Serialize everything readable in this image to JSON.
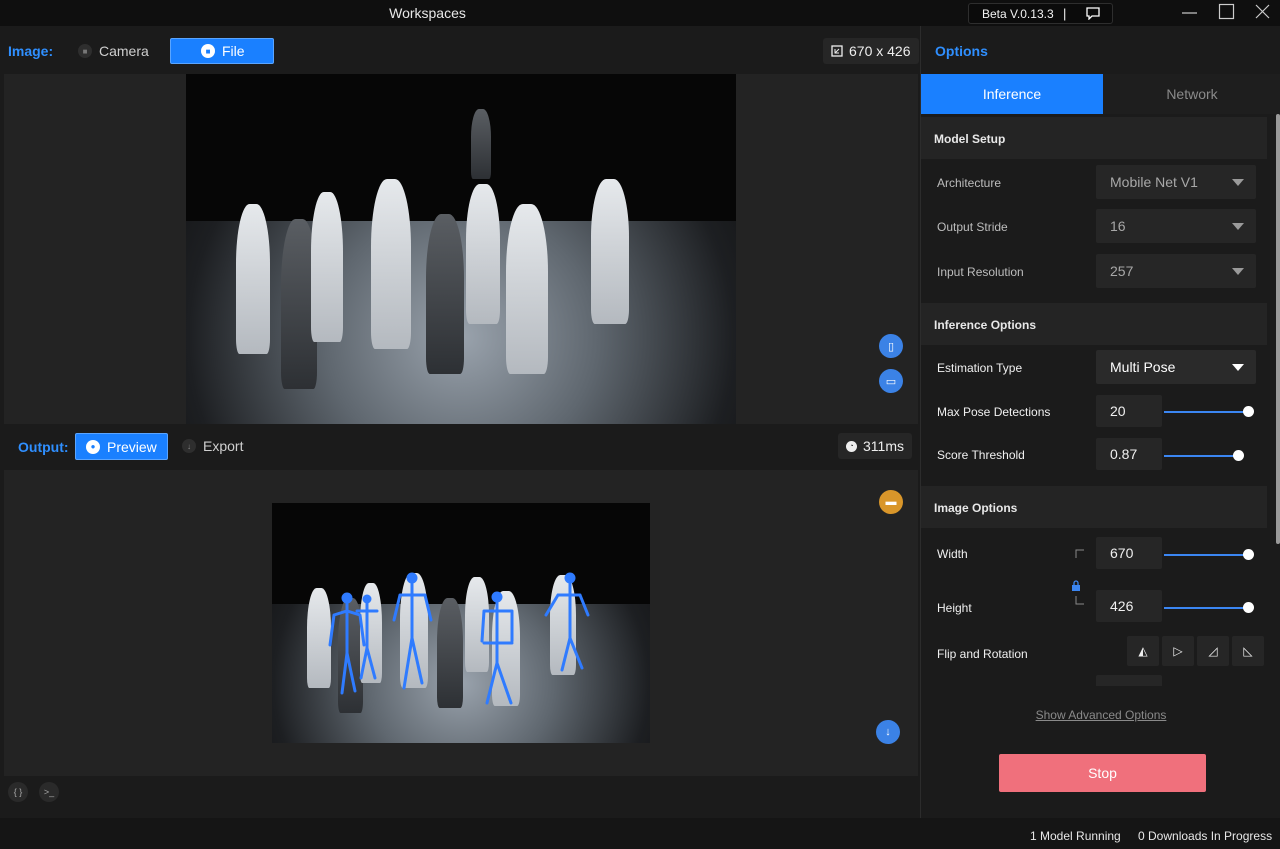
{
  "window": {
    "title": "Workspaces",
    "version": "Beta V.0.13.3",
    "separator": "|"
  },
  "image_panel": {
    "label": "Image:",
    "modes": [
      {
        "label": "Camera",
        "icon": "camera-icon"
      },
      {
        "label": "File",
        "icon": "file-icon"
      }
    ],
    "active_mode": "File",
    "dimensions": "670 x 426"
  },
  "output_panel": {
    "label": "Output:",
    "modes": [
      {
        "label": "Preview",
        "icon": "eye-icon"
      },
      {
        "label": "Export",
        "icon": "download-icon"
      }
    ],
    "active_mode": "Preview",
    "timing": "311ms"
  },
  "options": {
    "title": "Options",
    "tabs": [
      {
        "label": "Inference"
      },
      {
        "label": "Network"
      }
    ],
    "active_tab": "Inference",
    "model_setup": {
      "heading": "Model Setup",
      "architecture": {
        "label": "Architecture",
        "value": "Mobile Net V1"
      },
      "output_stride": {
        "label": "Output Stride",
        "value": "16"
      },
      "input_resolution": {
        "label": "Input Resolution",
        "value": "257"
      }
    },
    "inference_options": {
      "heading": "Inference Options",
      "estimation_type": {
        "label": "Estimation Type",
        "value": "Multi Pose"
      },
      "max_pose_detections": {
        "label": "Max Pose Detections",
        "value": "20",
        "fraction": 1.0
      },
      "score_threshold": {
        "label": "Score Threshold",
        "value": "0.87",
        "fraction": 0.87
      }
    },
    "image_options": {
      "heading": "Image Options",
      "width": {
        "label": "Width",
        "value": "670",
        "fraction": 1.0
      },
      "height": {
        "label": "Height",
        "value": "426",
        "fraction": 1.0
      },
      "flip_rotation": {
        "label": "Flip and Rotation"
      }
    },
    "advanced_link": "Show Advanced Options",
    "stop_label": "Stop"
  },
  "status": {
    "models": "1 Model Running",
    "downloads": "0 Downloads In Progress"
  },
  "colors": {
    "accent": "#1a80ff",
    "stop": "#f0707c",
    "skeleton": "#2f7bff"
  }
}
